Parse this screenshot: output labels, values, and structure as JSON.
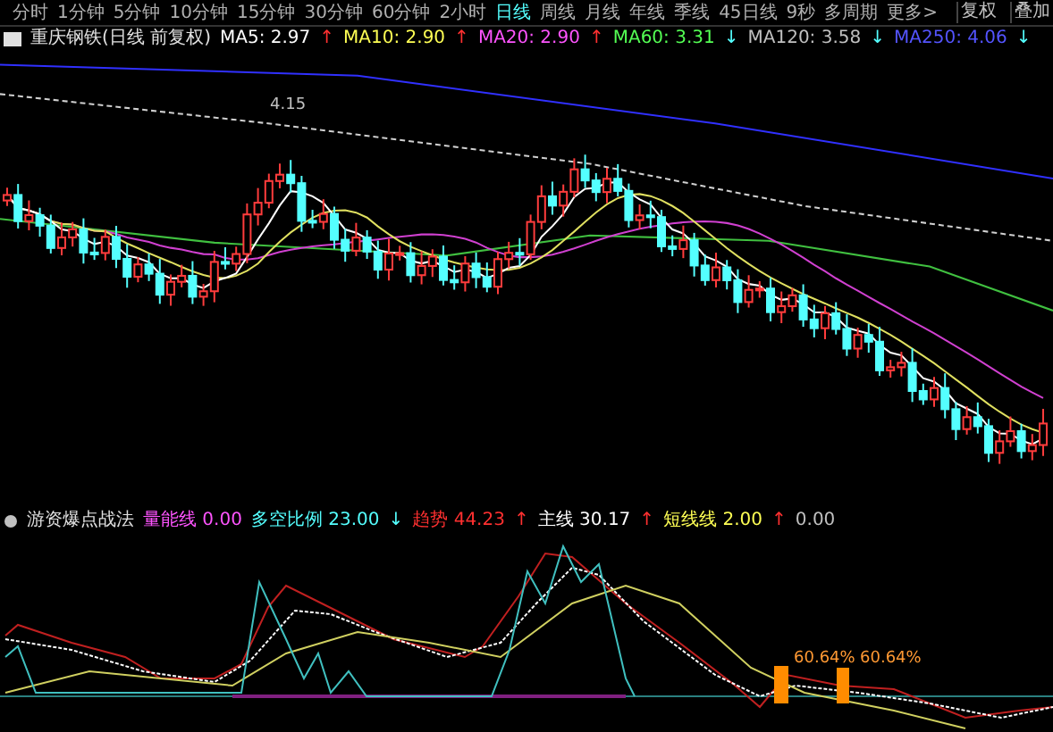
{
  "toolbar": {
    "tabs": [
      {
        "label": "分时",
        "selected": false
      },
      {
        "label": "1分钟",
        "selected": false
      },
      {
        "label": "5分钟",
        "selected": false
      },
      {
        "label": "10分钟",
        "selected": false
      },
      {
        "label": "15分钟",
        "selected": false
      },
      {
        "label": "30分钟",
        "selected": false
      },
      {
        "label": "60分钟",
        "selected": false
      },
      {
        "label": "2小时",
        "selected": false
      },
      {
        "label": "日线",
        "selected": true
      },
      {
        "label": "周线",
        "selected": false
      },
      {
        "label": "月线",
        "selected": false
      },
      {
        "label": "年线",
        "selected": false
      },
      {
        "label": "季线",
        "selected": false
      },
      {
        "label": "45日线",
        "selected": false
      },
      {
        "label": "9秒",
        "selected": false
      },
      {
        "label": "多周期",
        "selected": false
      },
      {
        "label": "更多>",
        "selected": false
      }
    ],
    "right_buttons": [
      "复权",
      "叠加"
    ]
  },
  "main_chart": {
    "title": "重庆钢铁(日线 前复权)",
    "indicators": [
      {
        "label": "MA5:",
        "value": "2.97",
        "arrow": "↑",
        "rising": true,
        "color": "#ffffff"
      },
      {
        "label": "MA10:",
        "value": "2.90",
        "arrow": "↑",
        "rising": true,
        "color": "#ffff54"
      },
      {
        "label": "MA20:",
        "value": "2.90",
        "arrow": "↑",
        "rising": true,
        "color": "#ff54ff"
      },
      {
        "label": "MA60:",
        "value": "3.31",
        "arrow": "↓",
        "rising": false,
        "color": "#54ff54"
      },
      {
        "label": "MA120:",
        "value": "3.58",
        "arrow": "↓",
        "rising": false,
        "color": "#c0c0c0"
      },
      {
        "label": "MA250:",
        "value": "4.06",
        "arrow": "↓",
        "rising": false,
        "color": "#5454ff"
      }
    ],
    "peak_label": "4.15"
  },
  "sub_chart": {
    "title": "游资爆点战法",
    "indicators": [
      {
        "label": "量能线",
        "value": "0.00",
        "color": "#ff54ff"
      },
      {
        "label": "多空比例",
        "value": "23.00",
        "arrow": "↓",
        "rising": false,
        "color": "#54ffff"
      },
      {
        "label": "趋势",
        "value": "44.23",
        "arrow": "↑",
        "rising": true,
        "color": "#ff3030"
      },
      {
        "label": "主线",
        "value": "30.17",
        "arrow": "↑",
        "rising": true,
        "color": "#ffffff"
      },
      {
        "label": "短线线",
        "value": "2.00",
        "arrow": "↑",
        "rising": true,
        "color": "#ffff54"
      },
      {
        "value": "0.00",
        "color": "#c0c0c0"
      }
    ],
    "signals": [
      {
        "label": "60.64%"
      },
      {
        "label": "60.64%"
      }
    ]
  }
}
